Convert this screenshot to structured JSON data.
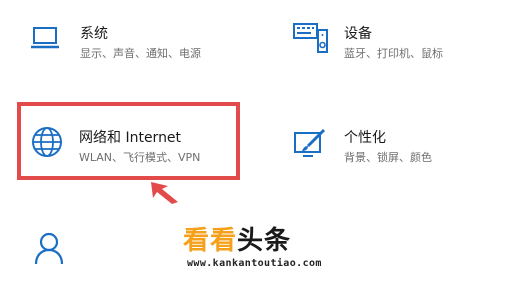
{
  "colors": {
    "icon_accent": "#1a6fc4",
    "highlight_border": "#e34a4a",
    "watermark_orange": "#f6a11c"
  },
  "tiles": [
    {
      "icon": "laptop-icon",
      "title": "系统",
      "desc": "显示、声音、通知、电源"
    },
    {
      "icon": "keyboard-speaker-icon",
      "title": "设备",
      "desc": "蓝牙、打印机、鼠标"
    },
    {
      "icon": "globe-icon",
      "title": "网络和 Internet",
      "desc": "WLAN、飞行模式、VPN"
    },
    {
      "icon": "paintbrush-screen-icon",
      "title": "个性化",
      "desc": "背景、锁屏、颜色"
    },
    {
      "icon": "person-icon"
    }
  ],
  "watermark": {
    "kan1": "看",
    "kan2": "看",
    "tou": "头",
    "tiao": "条",
    "url": "www.kankantoutiao.com"
  }
}
